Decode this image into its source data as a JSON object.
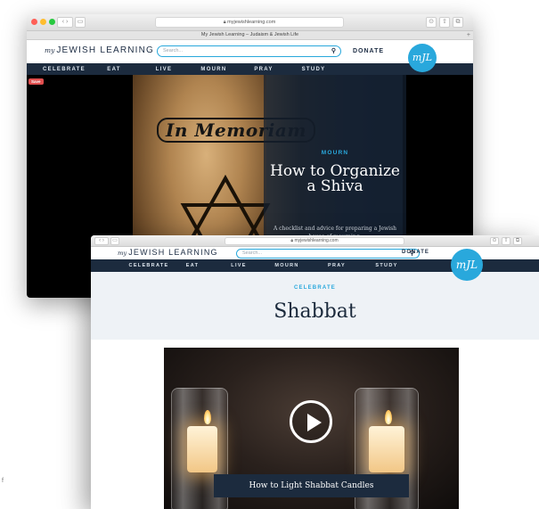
{
  "back_window": {
    "url": "myjewishlearning.com",
    "tab_title": "My Jewish Learning – Judaism & Jewish Life",
    "logo_my": "my",
    "logo_text": "JEWISH LEARNING",
    "search_placeholder": "Search...",
    "donate": "DONATE",
    "badge": "mJL",
    "nav": [
      "CELEBRATE",
      "EAT",
      "LIVE",
      "MOURN",
      "PRAY",
      "STUDY"
    ],
    "save_label": "Save",
    "photo_text": "In Memoriam",
    "hero": {
      "eyebrow": "MOURN",
      "title": "How to Organize a Shiva",
      "subtitle": "A checklist and advice for preparing a Jewish house of mourning."
    }
  },
  "front_window": {
    "url": "myjewishlearning.com",
    "logo_my": "my",
    "logo_text": "JEWISH LEARNING",
    "search_placeholder": "Search...",
    "donate": "DONATE",
    "badge": "mJL",
    "nav": [
      "CELEBRATE",
      "EAT",
      "LIVE",
      "MOURN",
      "PRAY",
      "STUDY"
    ],
    "category": {
      "eyebrow": "CELEBRATE",
      "title": "Shabbat"
    },
    "video": {
      "caption": "How to Light Shabbat Candles"
    }
  },
  "left_mark": "f",
  "colors": {
    "navy": "#1c2b3e",
    "accent_blue": "#29a8dc",
    "band": "#eef2f6"
  }
}
